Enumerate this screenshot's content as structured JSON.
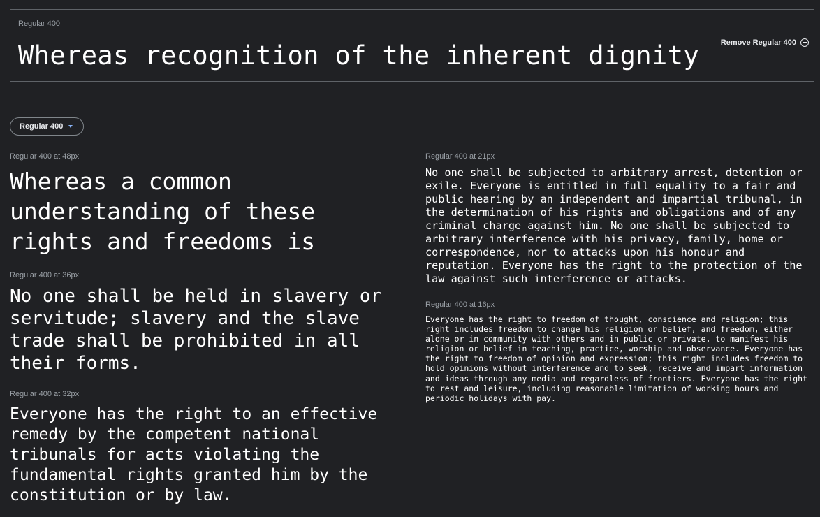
{
  "header": {
    "style_label": "Regular 400",
    "preview_text": "Whereas recognition of the inherent dignity",
    "remove_button_label": "Remove Regular 400",
    "remove_icon": "minus-circle-icon"
  },
  "controls": {
    "style_dropdown_value": "Regular 400",
    "dropdown_icon": "caret-down-icon",
    "accent_color": "#8ab4f8"
  },
  "samples": {
    "size48": {
      "label": "Regular 400 at 48px",
      "text": "Whereas a common understanding of these rights and freedoms is"
    },
    "size36": {
      "label": "Regular 400 at 36px",
      "text": "No one shall be held in slavery or servitude; slavery and the slave trade shall be prohibited in all their forms."
    },
    "size32": {
      "label": "Regular 400 at 32px",
      "text": "Everyone has the right to an effective remedy by the competent national tribunals for acts violating the fundamental rights granted him by the constitution or by law."
    },
    "size21": {
      "label": "Regular 400 at 21px",
      "text": "No one shall be subjected to arbitrary arrest, detention or exile. Everyone is entitled in full equality to a fair and public hearing by an independent and impartial tribunal, in the determination of his rights and obligations and of any criminal charge against him. No one shall be subjected to arbitrary interference with his privacy, family, home or correspondence, nor to attacks upon his honour and reputation. Everyone has the right to the protection of the law against such interference or attacks."
    },
    "size16": {
      "label": "Regular 400 at 16px",
      "text": "Everyone has the right to freedom of thought, conscience and religion; this right includes freedom to change his religion or belief, and freedom, either alone or in community with others and in public or private, to manifest his religion or belief in teaching, practice, worship and observance. Everyone has the right to freedom of opinion and expression; this right includes freedom to hold opinions without interference and to seek, receive and impart information and ideas through any media and regardless of frontiers. Everyone has the right to rest and leisure, including reasonable limitation of working hours and periodic holidays with pay."
    }
  },
  "colors": {
    "background": "#202124",
    "divider": "#5f6368",
    "label_text": "#9aa0a6",
    "sample_text": "#ffffff"
  }
}
